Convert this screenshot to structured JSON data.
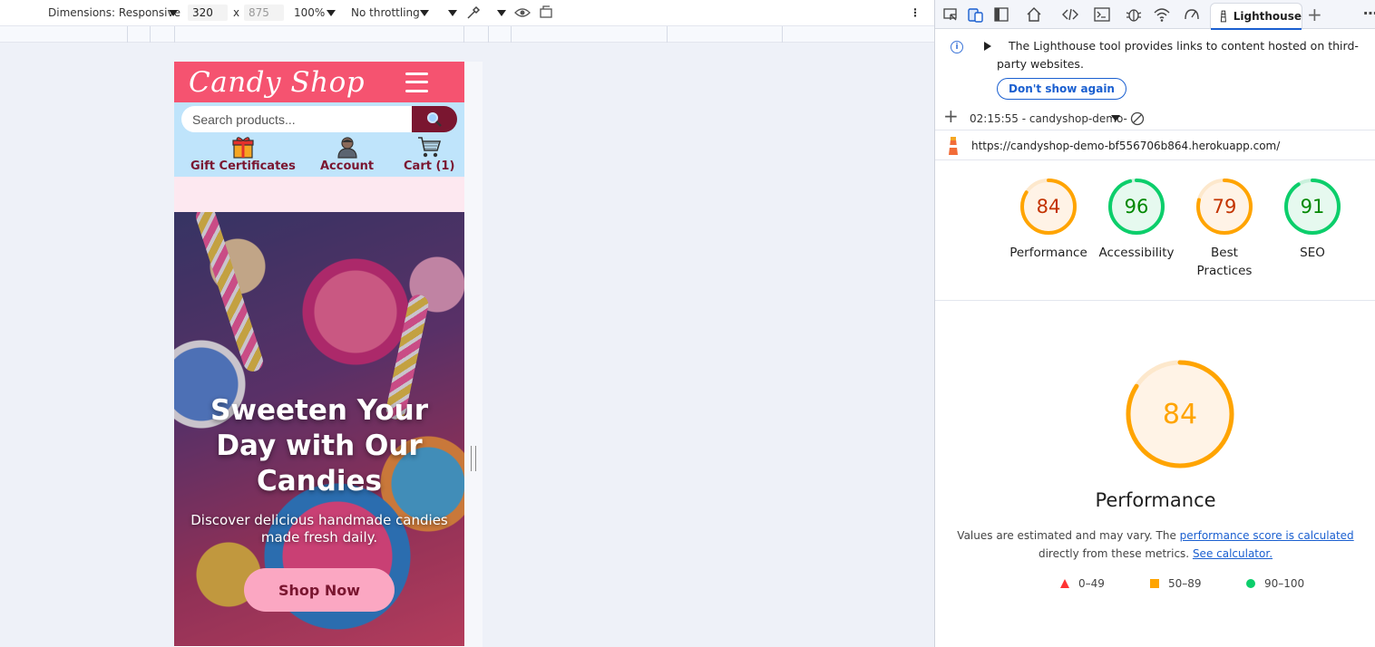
{
  "emulation": {
    "dimensions_label": "Dimensions: Responsive",
    "width_value": "320",
    "times": "x",
    "height_value": "875",
    "zoom": "100%",
    "throttling": "No throttling"
  },
  "site": {
    "logo": "Candy Shop",
    "search_placeholder": "Search products...",
    "nav": {
      "gift": "Gift Certificates",
      "account": "Account",
      "cart": "Cart (1)"
    },
    "hero_title": "Sweeten Your Day with Our Candies",
    "hero_subtitle": "Discover delicious handmade candies made fresh daily.",
    "hero_button": "Shop Now"
  },
  "devtools": {
    "active_tab": "Lighthouse",
    "notice": "The Lighthouse tool provides links to content hosted on third-party websites.",
    "dont_show": "Don't show again",
    "report_label": "02:15:55 - candyshop-demo-",
    "url": "https://candyshop-demo-bf556706b864.herokuapp.com/",
    "scores": [
      {
        "value": "84",
        "label": "Performance",
        "score": 84,
        "color": "#ffa400"
      },
      {
        "value": "96",
        "label": "Accessibility",
        "score": 96,
        "color": "#0cce6b"
      },
      {
        "value": "79",
        "label": "Best Practices",
        "score": 79,
        "color": "#ffa400"
      },
      {
        "value": "91",
        "label": "SEO",
        "score": 91,
        "color": "#0cce6b"
      }
    ],
    "main": {
      "score": "84",
      "score_value": 84,
      "title": "Performance",
      "desc_prefix": "Values are estimated and may vary. The ",
      "desc_link": "performance score is calculated",
      "desc_middle": "directly from these metrics. ",
      "desc_link2": "See calculator.",
      "legend": [
        "0–49",
        "50–89",
        "90–100"
      ]
    },
    "colors": {
      "fail": "#ff3333",
      "average": "#ffa400",
      "pass": "#0cce6b",
      "average_text": "#c33300",
      "pass_text": "#008800"
    }
  }
}
